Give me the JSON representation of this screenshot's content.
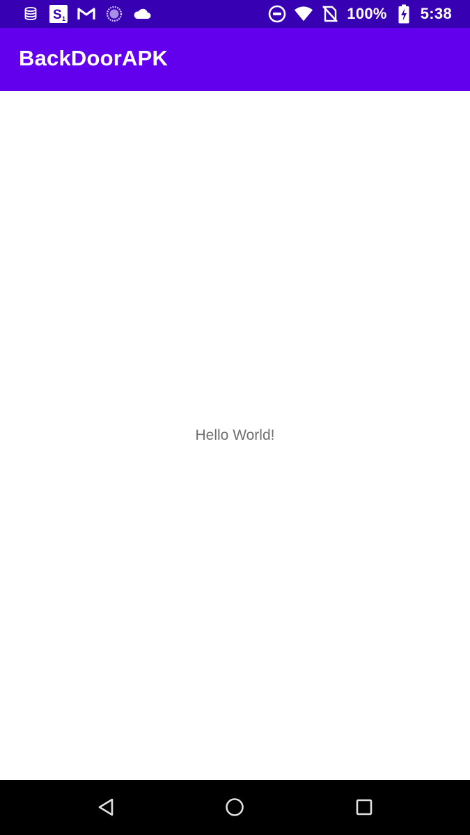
{
  "status_bar": {
    "battery_text": "100%",
    "time": "5:38",
    "left_icons": [
      "database-icon",
      "s1-app-icon",
      "gmail-icon",
      "loading-circle-icon",
      "cloud-icon"
    ],
    "right_icons": [
      "do-not-disturb-icon",
      "wifi-icon",
      "no-sim-icon",
      "battery-charging-icon"
    ]
  },
  "app_bar": {
    "title": "BackDoorAPK",
    "color": "#6200ee"
  },
  "main": {
    "message": "Hello World!"
  },
  "nav_bar": {
    "buttons": [
      "back-icon",
      "home-icon",
      "recents-icon"
    ]
  },
  "colors": {
    "status_bar": "#3700b3",
    "app_bar": "#6200ee",
    "background": "#ffffff",
    "text": "#6f6f6f"
  }
}
